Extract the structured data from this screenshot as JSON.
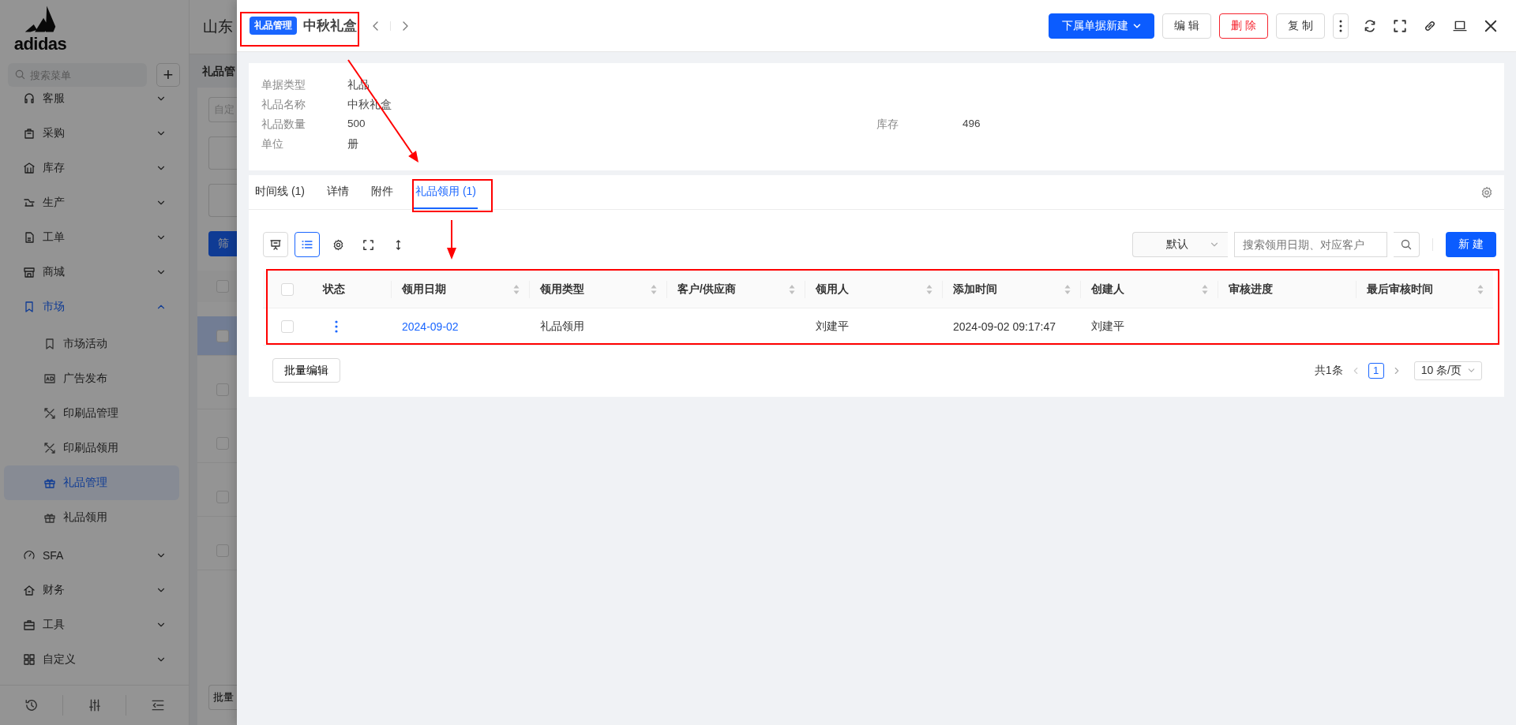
{
  "sidebar": {
    "logo": "adidas",
    "search": {
      "placeholder": "搜索菜单"
    },
    "add_button": "+",
    "menu": [
      {
        "label": "客服",
        "expanded": false
      },
      {
        "label": "采购",
        "expanded": false
      },
      {
        "label": "库存",
        "expanded": false
      },
      {
        "label": "生产",
        "expanded": false
      },
      {
        "label": "工单",
        "expanded": false
      },
      {
        "label": "商城",
        "expanded": false
      },
      {
        "label": "市场",
        "expanded": true,
        "children": [
          {
            "label": "市场活动",
            "selected": false
          },
          {
            "label": "广告发布",
            "selected": false
          },
          {
            "label": "印刷品管理",
            "selected": false
          },
          {
            "label": "印刷品领用",
            "selected": false
          },
          {
            "label": "礼品管理",
            "selected": true
          },
          {
            "label": "礼品领用",
            "selected": false
          }
        ]
      },
      {
        "label": "SFA",
        "expanded": false
      },
      {
        "label": "财务",
        "expanded": false
      },
      {
        "label": "工具",
        "expanded": false
      },
      {
        "label": "自定义",
        "expanded": false
      }
    ]
  },
  "background_page": {
    "title": "山东",
    "heading": "礼品管",
    "filter_placeholder": "自定",
    "filter_button": "筛",
    "select_all": {
      "checked": false
    },
    "rows": [
      {
        "checked": false,
        "selected": true
      },
      {
        "checked": false,
        "selected": false
      },
      {
        "checked": false,
        "selected": false
      },
      {
        "checked": false,
        "selected": false
      },
      {
        "checked": false,
        "selected": false
      }
    ],
    "batch_button": "批量"
  },
  "drawer": {
    "header": {
      "tag": "礼品管理",
      "title": "中秋礼盒",
      "actions": [
        {
          "label": "下属单据新建",
          "kind": "dropdown"
        },
        {
          "label": "编 辑",
          "kind": "default"
        },
        {
          "label": "删 除",
          "kind": "danger"
        },
        {
          "label": "复 制",
          "kind": "default"
        }
      ]
    },
    "info": {
      "rows": [
        [
          {
            "label": "单据类型",
            "value": "礼品"
          }
        ],
        [
          {
            "label": "礼品名称",
            "value": "中秋礼盒"
          }
        ],
        [
          {
            "label": "礼品数量",
            "value": "500"
          },
          {
            "label": "库存",
            "value": "496"
          }
        ],
        [
          {
            "label": "单位",
            "value": "册"
          }
        ]
      ]
    },
    "tabs": [
      {
        "label": "时间线 (1)",
        "selected": false
      },
      {
        "label": "详情",
        "selected": false
      },
      {
        "label": "附件",
        "selected": false
      },
      {
        "label": "礼品领用 (1)",
        "selected": true
      }
    ],
    "view_modes": [
      {
        "selected": false
      },
      {
        "selected": true
      }
    ],
    "filter": {
      "value": "默认"
    },
    "search": {
      "placeholder": "搜索领用日期、对应客户"
    },
    "new_button": "新 建",
    "table": {
      "select_all": {
        "checked": false
      },
      "columns": [
        {
          "label": "状态",
          "sortable": false
        },
        {
          "label": "领用日期",
          "sortable": true
        },
        {
          "label": "领用类型",
          "sortable": true
        },
        {
          "label": "客户/供应商",
          "sortable": true
        },
        {
          "label": "领用人",
          "sortable": true
        },
        {
          "label": "添加时间",
          "sortable": true
        },
        {
          "label": "创建人",
          "sortable": true
        },
        {
          "label": "审核进度",
          "sortable": false
        },
        {
          "label": "最后审核时间",
          "sortable": true
        }
      ],
      "rows": [
        {
          "checked": false,
          "cells": [
            {
              "kind": "menu"
            },
            {
              "kind": "link",
              "text": "2024-09-02"
            },
            {
              "kind": "text",
              "text": "礼品领用"
            },
            {
              "kind": "empty"
            },
            {
              "kind": "text",
              "text": "刘建平"
            },
            {
              "kind": "text",
              "text": "2024-09-02 09:17:47"
            },
            {
              "kind": "text",
              "text": "刘建平"
            },
            {
              "kind": "empty"
            },
            {
              "kind": "empty"
            }
          ]
        }
      ]
    },
    "batch_button": "批量编辑",
    "pagination": {
      "total": "共1条",
      "pages": [
        {
          "label": "1",
          "selected": true
        }
      ],
      "page_size": "10 条/页"
    }
  }
}
